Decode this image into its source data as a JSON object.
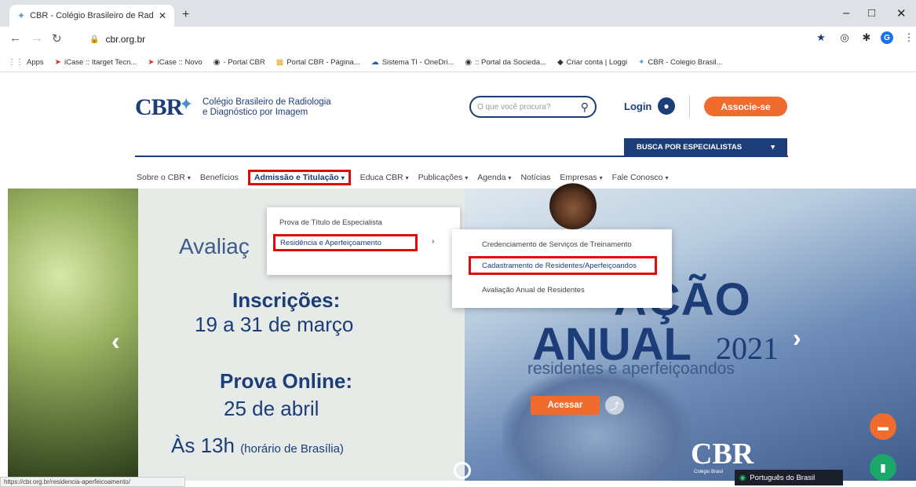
{
  "browser": {
    "tab_title": "CBR - Colégio Brasileiro de Radi...",
    "url": "cbr.org.br",
    "bookmarks": [
      {
        "icon": "apps-icon",
        "label": "Apps"
      },
      {
        "icon": "target-icon",
        "label": "iCase :: Itarget Tecn..."
      },
      {
        "icon": "target-icon",
        "label": "iCase :: Novo"
      },
      {
        "icon": "globe-icon",
        "label": "- Portal CBR"
      },
      {
        "icon": "grid-icon",
        "label": "Portal CBR - Página..."
      },
      {
        "icon": "cloud-icon",
        "label": "Sistema TI - OneDri..."
      },
      {
        "icon": "globe-icon",
        "label": ":: Portal da Socieda..."
      },
      {
        "icon": "diamond-icon",
        "label": "Criar conta | Loggi"
      },
      {
        "icon": "cbr-icon",
        "label": "CBR - Colegio Brasil..."
      }
    ],
    "status_url": "https://cbr.org.br/residencia-aperfeicoamento/"
  },
  "header": {
    "logo": "CBR",
    "logo_line1": "Colégio Brasileiro de Radiologia",
    "logo_line2": "e Diagnóstico por Imagem",
    "search_placeholder": "O que você procura?",
    "login": "Login",
    "associe": "Associe-se",
    "busca": "BUSCA POR ESPECIALISTAS"
  },
  "nav": [
    {
      "label": "Sobre o CBR",
      "chevron": true
    },
    {
      "label": "Benefícios",
      "chevron": false
    },
    {
      "label": "Admissão e Titulação",
      "chevron": true,
      "active": true
    },
    {
      "label": "Educa CBR",
      "chevron": true
    },
    {
      "label": "Publicações",
      "chevron": true
    },
    {
      "label": "Agenda",
      "chevron": true
    },
    {
      "label": "Notícias",
      "chevron": false
    },
    {
      "label": "Empresas",
      "chevron": true
    },
    {
      "label": "Fale Conosco",
      "chevron": true
    }
  ],
  "menu1": {
    "item1": "Prova de Título de Especialista",
    "item2": "Residência e Aperfeiçoamento"
  },
  "menu2": {
    "item1": "Credenciamento de Serviços de Treinamento",
    "item2": "Cadastramento de Residentes/Aperfeiçoandos",
    "item3": "Avaliação Anual de Residentes"
  },
  "hero": {
    "avaliacao_left": "Avaliaç",
    "inscricoes": "Inscrições:",
    "datas": "19 a 31 de março",
    "prova": "Prova Online:",
    "prova_data": "25 de abril",
    "horario": "Às 13h",
    "horario_small": "(horário de Brasília)",
    "avaliacao_right": "AÇÃO",
    "anual": "ANUAL",
    "year": "2021",
    "resid": "residentes e aperfeiçoandos",
    "acessar": "Acessar",
    "cbr": "CBR",
    "cbr_sub": "Colégio Brasil"
  },
  "lang": "Português do Brasil"
}
